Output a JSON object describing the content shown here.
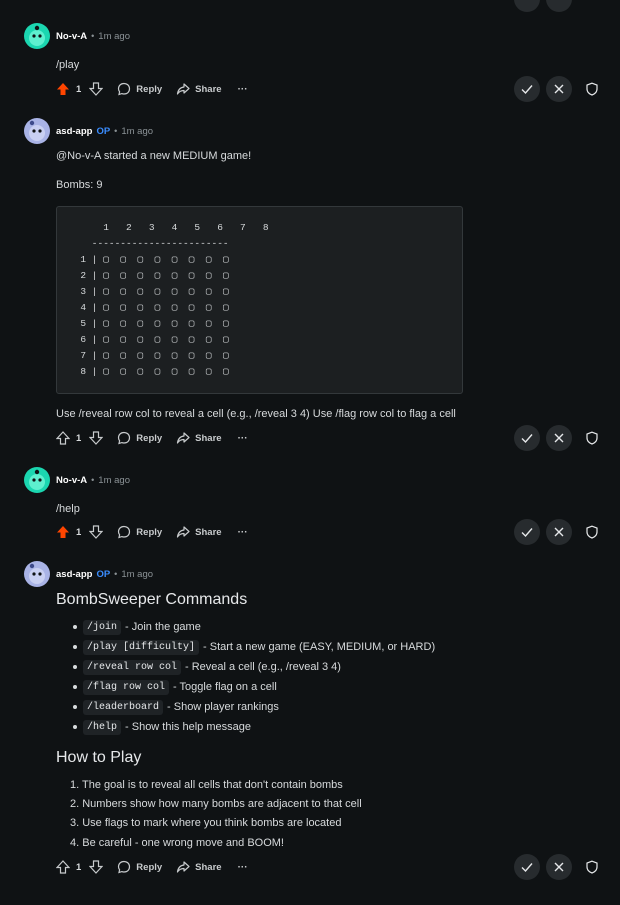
{
  "actions": {
    "reply_label": "Reply",
    "share_label": "Share",
    "more_label": "···"
  },
  "comments": [
    {
      "username": "No-v-A",
      "time": "1m ago",
      "score": "1",
      "upvoted": true,
      "text": "/play"
    },
    {
      "username": "asd-app",
      "op_badge": "OP",
      "time": "1m ago",
      "score": "1",
      "upvoted": false,
      "line1": "@No-v-A started a new MEDIUM game!",
      "line2": "Bombs: 9",
      "grid_lines": [
        "      1   2   3   4   5   6   7   8",
        "    ------------------------",
        "  1 | ▢  ▢  ▢  ▢  ▢  ▢  ▢  ▢",
        "  2 | ▢  ▢  ▢  ▢  ▢  ▢  ▢  ▢",
        "  3 | ▢  ▢  ▢  ▢  ▢  ▢  ▢  ▢",
        "  4 | ▢  ▢  ▢  ▢  ▢  ▢  ▢  ▢",
        "  5 | ▢  ▢  ▢  ▢  ▢  ▢  ▢  ▢",
        "  6 | ▢  ▢  ▢  ▢  ▢  ▢  ▢  ▢",
        "  7 | ▢  ▢  ▢  ▢  ▢  ▢  ▢  ▢",
        "  8 | ▢  ▢  ▢  ▢  ▢  ▢  ▢  ▢"
      ],
      "footer": "Use /reveal row col to reveal a cell (e.g., /reveal 3 4) Use /flag row col to flag a cell"
    },
    {
      "username": "No-v-A",
      "time": "1m ago",
      "score": "1",
      "upvoted": true,
      "text": "/help"
    },
    {
      "username": "asd-app",
      "op_badge": "OP",
      "time": "1m ago",
      "score": "1",
      "upvoted": false,
      "heading": "BombSweeper Commands",
      "commands": [
        {
          "code": "/join",
          "desc": "- Join the game"
        },
        {
          "code": "/play [difficulty]",
          "desc": "- Start a new game (EASY, MEDIUM, or HARD)"
        },
        {
          "code": "/reveal row col",
          "desc": "- Reveal a cell (e.g., /reveal 3 4)"
        },
        {
          "code": "/flag row col",
          "desc": "- Toggle flag on a cell"
        },
        {
          "code": "/leaderboard",
          "desc": "- Show player rankings"
        },
        {
          "code": "/help",
          "desc": "- Show this help message"
        }
      ],
      "heading2": "How to Play",
      "steps": [
        "1. The goal is to reveal all cells that don't contain bombs",
        "2. Numbers show how many bombs are adjacent to that cell",
        "3. Use flags to mark where you think bombs are located",
        "4. Be careful - one wrong move and BOOM!"
      ]
    }
  ],
  "colors": {
    "upvote_active": "#ff4500",
    "op_badge": "#3a8dff",
    "background": "#0f1214"
  }
}
